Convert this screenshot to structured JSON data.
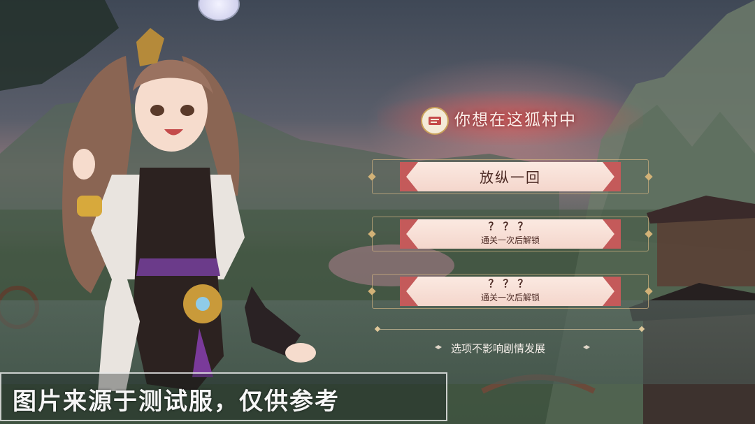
{
  "dialog": {
    "title": "你想在这狐村中",
    "title_icon": "scroll-icon"
  },
  "options": [
    {
      "label": "放纵一回",
      "locked": false
    },
    {
      "label": "？？？",
      "sub": "通关一次后解锁",
      "locked": true
    },
    {
      "label": "？？？",
      "sub": "通关一次后解锁",
      "locked": true
    }
  ],
  "note": "选项不影响剧情发展",
  "watermark": "图片来源于测试服，仅供参考",
  "colors": {
    "accent_red": "#c45a5a",
    "plate": "#fbe9e1",
    "gold": "#d2b277",
    "text_dark": "#4c2a24"
  }
}
